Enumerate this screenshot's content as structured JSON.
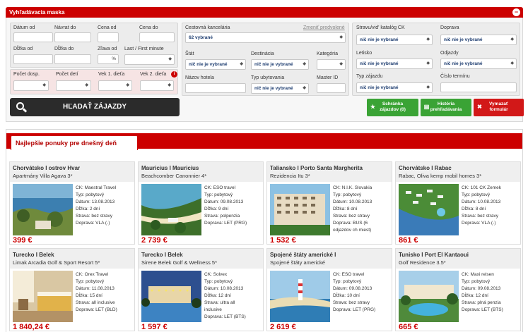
{
  "mask": {
    "title": "Vyhľadávacia maska",
    "collapse": "−"
  },
  "dates": {
    "date_from": "Dátum od",
    "return_to": "Návrat do",
    "length_from": "Dĺžka od",
    "length_to": "Dĺžka do",
    "price_from": "Cena od",
    "price_to": "Cena do",
    "discount_from": "Zľava od",
    "last_first": "Last / First minute",
    "percent": "%"
  },
  "people": {
    "adults": "Počet dosp.",
    "children": "Počet detí",
    "age1": "Vek 1. dieťa",
    "age2": "Vek 2. dieťa",
    "info": "i"
  },
  "agency": {
    "label": "Cestovná kancelária",
    "reset": "Zmeniť predvolené",
    "value": "62 vybrané",
    "country": "Štát",
    "destination": "Destinácia",
    "category": "Kategória",
    "hotel_name": "Názov hotela",
    "accommodation_type": "Typ ubytovania",
    "master_id": "Master ID",
    "none_selected": "nič nie je vybrané"
  },
  "right": {
    "catalog": "Stravu/vid' katalóg CK",
    "transport": "Doprava",
    "airport": "Letisko",
    "departures": "Odjazdy",
    "trip_type": "Typ zájazdu",
    "term_number": "Číslo termínu",
    "none_selected": "nič nie je vybrané"
  },
  "buttons": {
    "search": "HĽADAŤ ZÁJAZDY",
    "wishlist_l1": "Schránka",
    "wishlist_l2": "zájazdov (0)",
    "history_l1": "História",
    "history_l2": "prehľadávania",
    "clear_l1": "Vymazať",
    "clear_l2": "formulár"
  },
  "offers": {
    "title": "Najlepšie ponuky pre dnešný deň",
    "cards": [
      {
        "title": "Chorvátsko I ostrov Hvar",
        "subtitle": "Apartmány Villa Agava 3*",
        "agency": "CK: Maestral Travel",
        "stay": "Typ: pobytový",
        "date": "Dátum: 13.08.2013",
        "length": "Dĺžka: 2 dní",
        "board": "Strava: bez stravy",
        "transport": "Doprava: VLA (-)",
        "extra": "",
        "price": "399 €"
      },
      {
        "title": "Mauricius I Mauricius",
        "subtitle": "Beachcomber Canonnier 4*",
        "agency": "CK: ESO travel",
        "stay": "Typ: pobytový",
        "date": "Dátum: 09.08.2013",
        "length": "Dĺžka: 9 dní",
        "board": "Strava: polpenzia",
        "transport": "Doprava: LET (PRG)",
        "extra": "",
        "price": "2 739 €"
      },
      {
        "title": "Taliansko I Porto Santa Margherita",
        "subtitle": "Rezidencia Itu 3*",
        "agency": "CK: N.I.K. Slovakia",
        "stay": "Typ: pobytový",
        "date": "Dátum: 10.08.2013",
        "length": "Dĺžka: 8 dní",
        "board": "Strava: bez stravy",
        "transport": "Doprava: BUS (6",
        "extra": "odjazdov ch miest)",
        "price": "1 532 €"
      },
      {
        "title": "Chorvátsko I Rabac",
        "subtitle": "Rabac, Oliva kemp mobil homes 3*",
        "agency": "CK: 101 CK Zemek",
        "stay": "Typ: pobytový",
        "date": "Dátum: 10.08.2013",
        "length": "Dĺžka: 8 dní",
        "board": "Strava: bez stravy",
        "transport": "Doprava: VLA (-)",
        "extra": "",
        "price": "861 €"
      },
      {
        "title": "Turecko I Belek",
        "subtitle": "Limak Arcadia Golf & Sport Resort 5*",
        "agency": "CK: Orex Travel",
        "stay": "Typ: pobytový",
        "date": "Dátum: 11.08.2013",
        "length": "Dĺžka: 15 dní",
        "board": "Strava: all inclusive",
        "transport": "Doprava: LET (BLD)",
        "extra": "",
        "price": "1 840,24 €"
      },
      {
        "title": "Turecko I Belek",
        "subtitle": "Sirene Belek Golf & Wellness 5*",
        "agency": "CK: Solvex",
        "stay": "Typ: pobytový",
        "date": "Dátum: 10.08.2013",
        "length": "Dĺžka: 12 dní",
        "board": "Strava: ultra all",
        "transport": "inclusive",
        "extra": "Doprava: LET (BTS)",
        "price": "1 597 €"
      },
      {
        "title": "Spojené štáty americké I",
        "subtitle": "Spojené štáty americké",
        "agency": "CK: ESO travel",
        "stay": "Typ: pobytový",
        "date": "Dátum: 09.08.2013",
        "length": "Dĺžka: 10 dní",
        "board": "Strava: bez stravy",
        "transport": "Doprava: LET (PRG)",
        "extra": "",
        "price": "2 619 €"
      },
      {
        "title": "Tunisko I Port El Kantaoui",
        "subtitle": "Golf Residence 3.5*",
        "agency": "CK: Maxi relsen",
        "stay": "Typ: pobytový",
        "date": "Dátum: 09.08.2013",
        "length": "Dĺžka: 12 dní",
        "board": "Strava: plná penzia",
        "transport": "Doprava: LET (BTS)",
        "extra": "",
        "price": "665 €"
      }
    ]
  },
  "colors": {
    "brand_red": "#cc0000",
    "dark_button": "#2b2b2b",
    "green_button": "#3aa335",
    "price": "#cc0000"
  }
}
